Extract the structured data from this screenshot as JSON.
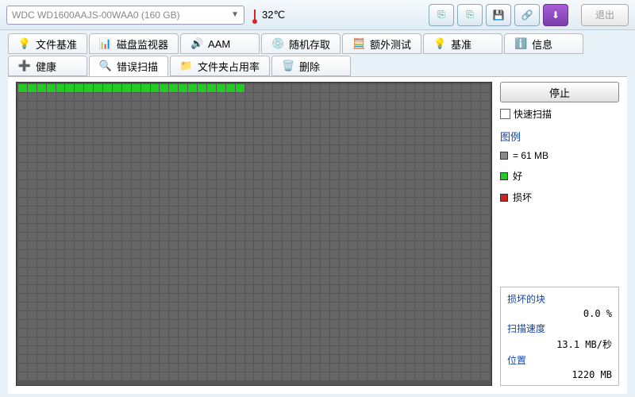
{
  "drive": {
    "label": "WDC WD1600AAJS-00WAA0 (160 GB)"
  },
  "temperature": {
    "value": "32℃"
  },
  "exit": {
    "label": "退出"
  },
  "tabs": {
    "file_baseline": "文件基准",
    "disk_monitor": "磁盘监视器",
    "aam": "AAM",
    "random_access": "随机存取",
    "extra_test": "额外测试",
    "baseline": "基准",
    "info": "信息",
    "health": "健康",
    "error_scan": "错误扫描",
    "folder_usage": "文件夹占用率",
    "delete": "删除"
  },
  "controls": {
    "stop": "停止",
    "quick_scan": "快速扫描"
  },
  "legend": {
    "title": "图例",
    "block_eq": "= 61 MB",
    "good": "好",
    "bad": "损坏"
  },
  "stats": {
    "damaged_label": "损坏的块",
    "damaged_value": "0.0 %",
    "speed_label": "扫描速度",
    "speed_value": "13.1 MB/秒",
    "position_label": "位置",
    "position_value": "1220 MB"
  },
  "scan": {
    "total_cols": 50,
    "total_rows": 34,
    "scanned_blocks": 24
  }
}
